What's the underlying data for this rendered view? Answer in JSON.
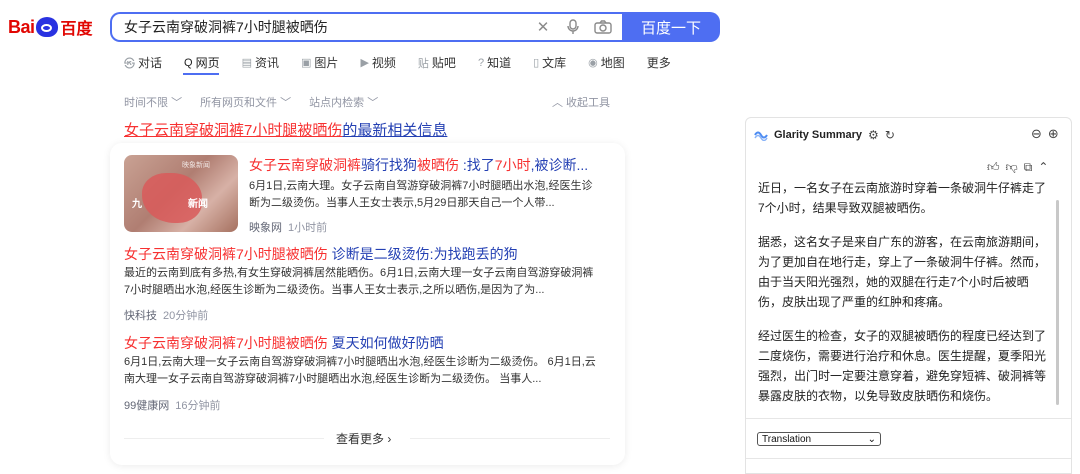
{
  "logo": {
    "bai": "Bai",
    "cn": "百度"
  },
  "search": {
    "query": "女子云南穿破洞裤7小时腿被晒伤",
    "button_label": "百度一下"
  },
  "tabs": [
    {
      "icon": "chat-icon",
      "glyph": "㉿",
      "label": "对话"
    },
    {
      "icon": "search-icon",
      "glyph": "Q",
      "label": "网页"
    },
    {
      "icon": "news-icon",
      "glyph": "▤",
      "label": "资讯"
    },
    {
      "icon": "image-icon",
      "glyph": "▣",
      "label": "图片"
    },
    {
      "icon": "video-icon",
      "glyph": "▶",
      "label": "视频"
    },
    {
      "icon": "tieba-icon",
      "glyph": "贴",
      "label": "贴吧"
    },
    {
      "icon": "zhidao-icon",
      "glyph": "?",
      "label": "知道"
    },
    {
      "icon": "wenku-icon",
      "glyph": "▯",
      "label": "文库"
    },
    {
      "icon": "map-icon",
      "glyph": "◉",
      "label": "地图"
    },
    {
      "icon": "",
      "glyph": "",
      "label": "更多"
    }
  ],
  "filters": {
    "time": "时间不限",
    "type": "所有网页和文件",
    "site": "站点内检索",
    "collapse": "收起工具"
  },
  "latest": {
    "prefix": "女子云南穿破洞裤7小时腿被晒伤",
    "suffix": "的最新相关信息"
  },
  "thumb": {
    "tag": "映象新闻",
    "t1": "九",
    "t2": "新闻"
  },
  "results": [
    {
      "title_red": "女子云南穿破洞裤",
      "title_blue1": "骑行找狗",
      "title_red2": "被晒伤",
      "title_blue2": " :找了",
      "title_red3": "7小时",
      "title_blue3": ",被诊断...",
      "desc1": "6月1日,云南大理。女子云南自驾游穿破洞裤7小时腿晒出水泡,经医生诊",
      "desc2": "断为二级烫伤。当事人王女士表示,5月29日那天自己一个人带...",
      "source": "映象网",
      "time": "1小时前"
    },
    {
      "title_red": "女子云南穿破洞裤7小时腿被晒伤",
      "title_blue": " 诊断是二级烫伤:为找跑丢的狗",
      "desc1": "最近的云南到底有多热,有女生穿破洞裤居然能晒伤。6月1日,云南大理一女子云南自驾游穿破洞裤",
      "desc2": "7小时腿晒出水泡,经医生诊断为二级烫伤。当事人王女士表示,之所以晒伤,是因为了为...",
      "source": "快科技",
      "time": "20分钟前"
    },
    {
      "title_red": "女子云南穿破洞裤7小时腿被晒伤",
      "title_blue": " 夏天如何做好防晒",
      "desc1": "6月1日,云南大理一女子云南自驾游穿破洞裤7小时腿晒出水泡,经医生诊断为二级烫伤。 6月1日,云",
      "desc2": "南大理一女子云南自驾游穿破洞裤7小时腿晒出水泡,经医生诊断为二级烫伤。 当事人...",
      "source": "99健康网",
      "time": "16分钟前"
    }
  ],
  "more": {
    "label": "查看更多 ›"
  },
  "glarity": {
    "title": "Glarity Summary",
    "paragraphs": [
      "近日，一名女子在云南旅游时穿着一条破洞牛仔裤走了7个小时，结果导致双腿被晒伤。",
      "据悉，这名女子是来自广东的游客，在云南旅游期间，为了更加自在地行走，穿上了一条破洞牛仔裤。然而，由于当天阳光强烈，她的双腿在行走7个小时后被晒伤，皮肤出现了严重的红肿和疼痛。",
      "经过医生的检查，女子的双腿被晒伤的程度已经达到了二度烧伤，需要进行治疗和休息。医生提醒，夏季阳光强烈，出门时一定要注意穿着，避免穿短裤、破洞裤等暴露皮肤的衣物，以免导致皮肤晒伤和烧伤。"
    ],
    "translation_label": "Translation"
  },
  "colors": {
    "accent": "#4e6ef2",
    "title_red": "#f73131",
    "title_blue": "#2440b3"
  }
}
